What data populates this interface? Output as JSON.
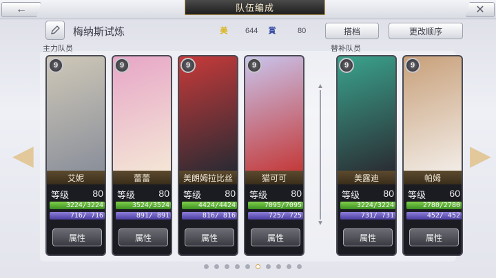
{
  "header": {
    "title": "队伍编成",
    "back_icon": "arrow-left-icon",
    "close_icon": "close-icon"
  },
  "team": {
    "name": "梅纳斯试炼",
    "stat_a_icon": "美",
    "stat_a_value": "644",
    "stat_b_icon": "賞",
    "stat_b_value": "80",
    "button_set": "搭档",
    "button_order": "更改顺序"
  },
  "labels": {
    "main": "主力队员",
    "sub": "替补队员"
  },
  "characters": [
    {
      "name": "艾妮",
      "rarity": "9",
      "level_label": "等级",
      "level": "80",
      "hp": "3224/3224",
      "mp": "716/ 716",
      "attr": "属性",
      "colors": [
        "#cfc8b8",
        "#8a8f9a"
      ]
    },
    {
      "name": "蕾蕾",
      "rarity": "9",
      "level_label": "等级",
      "level": "80",
      "hp": "3524/3524",
      "mp": "891/ 891",
      "attr": "属性",
      "colors": [
        "#e7a6c7",
        "#f4e6d6"
      ]
    },
    {
      "name": "美朗姆拉比丝",
      "rarity": "9",
      "level_label": "等级",
      "level": "80",
      "hp": "4424/4424",
      "mp": "816/ 816",
      "attr": "属性",
      "colors": [
        "#c73a3a",
        "#2a2a33"
      ]
    },
    {
      "name": "猫可可",
      "rarity": "9",
      "level_label": "等级",
      "level": "80",
      "hp": "7095/7095",
      "mp": "725/ 725",
      "attr": "属性",
      "colors": [
        "#c9c4ec",
        "#c33a3a"
      ]
    },
    {
      "name": "美露迪",
      "rarity": "9",
      "level_label": "等级",
      "level": "80",
      "hp": "3224/3224",
      "mp": "731/ 731",
      "attr": "属性",
      "colors": [
        "#3aa38d",
        "#2a2d33"
      ]
    },
    {
      "name": "帕姆",
      "rarity": "9",
      "level_label": "等级",
      "level": "60",
      "hp": "2780/2780",
      "mp": "452/ 452",
      "attr": "属性",
      "colors": [
        "#c8a07a",
        "#f2ece6"
      ]
    }
  ],
  "pagination": {
    "total": 10,
    "active_index": 5
  }
}
